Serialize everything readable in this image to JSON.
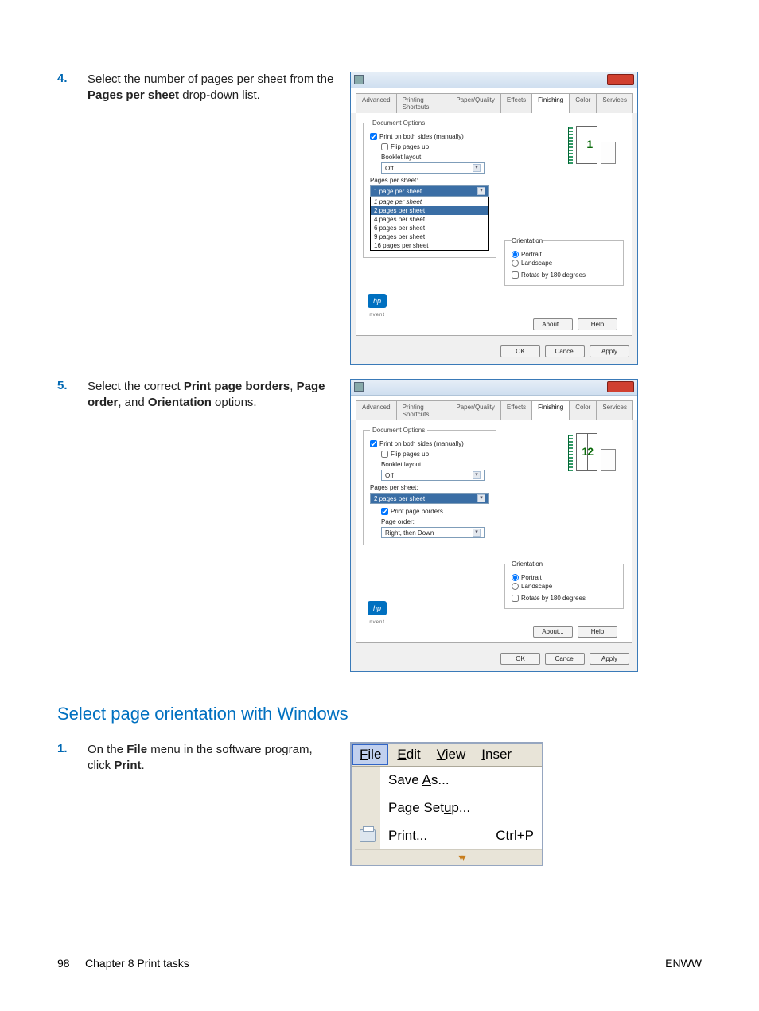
{
  "steps": {
    "s4": {
      "num": "4.",
      "text_a": "Select the number of pages per sheet from the ",
      "bold": "Pages per sheet",
      "text_b": " drop-down list."
    },
    "s5": {
      "num": "5.",
      "text_a": "Select the correct ",
      "b1": "Print page borders",
      "sep1": ", ",
      "b2": "Page order",
      "sep2": ", and ",
      "b3": "Orientation",
      "text_b": " options."
    },
    "s1": {
      "num": "1.",
      "text_a": "On the ",
      "b1": "File",
      "text_b": " menu in the software program, click ",
      "b2": "Print",
      "text_c": "."
    }
  },
  "section_heading": "Select page orientation with Windows",
  "dialog": {
    "tabs": [
      "Advanced",
      "Printing Shortcuts",
      "Paper/Quality",
      "Effects",
      "Finishing",
      "Color",
      "Services"
    ],
    "active_tab": "Finishing",
    "doc_options_legend": "Document Options",
    "print_both_sides": "Print on both sides (manually)",
    "flip_pages_up": "Flip pages up",
    "booklet_layout_label": "Booklet layout:",
    "booklet_off": "Off",
    "pages_per_sheet_label": "Pages per sheet:",
    "pps_selected_1": "1 page per sheet",
    "pps_options": [
      "1 page per sheet",
      "2 pages per sheet",
      "4 pages per sheet",
      "6 pages per sheet",
      "9 pages per sheet",
      "16 pages per sheet"
    ],
    "pps_selected_2": "2 pages per sheet",
    "print_page_borders": "Print page borders",
    "page_order_label": "Page order:",
    "page_order_value": "Right, then Down",
    "orientation_legend": "Orientation",
    "portrait": "Portrait",
    "landscape": "Landscape",
    "rotate": "Rotate by 180 degrees",
    "about": "About...",
    "help": "Help",
    "ok": "OK",
    "cancel": "Cancel",
    "apply": "Apply",
    "hp": "hp",
    "invent": "invent"
  },
  "menu": {
    "file": "File",
    "edit": "Edit",
    "view": "View",
    "insert": "Inser",
    "save_as": "Save As...",
    "page_setup": "Page Setup...",
    "print": "Print...",
    "print_shortcut": "Ctrl+P",
    "underline": {
      "file": "F",
      "edit": "E",
      "view": "V",
      "insert": "I",
      "save_as": "A",
      "page_setup": "u",
      "print": "P"
    }
  },
  "footer": {
    "page": "98",
    "chapter": "Chapter 8   Print tasks",
    "right": "ENWW"
  }
}
